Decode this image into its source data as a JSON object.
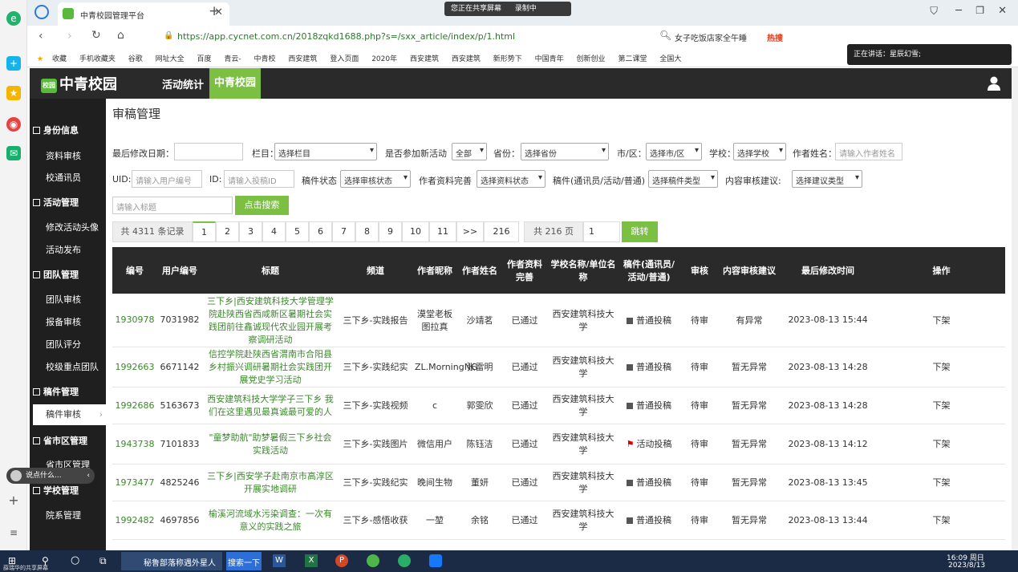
{
  "browser": {
    "tab_title": "中青校园管理平台",
    "url": "https://app.cycnet.com.cn/2018zqkd1688.php?s=/sxx_article/index/p/1.html",
    "search_hint": "女子吃饭店家全午睡",
    "hot_label": "热搜",
    "share_status": "您正在共享屏幕",
    "recording": "录制中",
    "speaking": "正在讲话：星辰幻雪;",
    "bookmarks": [
      "收藏",
      "手机收藏夹",
      "谷歌",
      "网址大全",
      "百度",
      "青云-",
      "中青校",
      "西安建筑",
      "登入页面",
      "2020年",
      "西安建筑",
      "西安建筑",
      "新形势下",
      "中国青年",
      "创新创业",
      "第二课堂",
      "全国大"
    ]
  },
  "header": {
    "logo": "中青校园",
    "logo_badge": "校园",
    "nav": [
      "活动统计",
      "中青校园"
    ]
  },
  "sidebar": {
    "groups": [
      {
        "title": "身份信息",
        "items": [
          "资料审核",
          "校通讯员"
        ]
      },
      {
        "title": "活动管理",
        "items": [
          "修改活动头像",
          "活动发布"
        ]
      },
      {
        "title": "团队管理",
        "items": [
          "团队审核",
          "报备审核",
          "团队评分",
          "校级重点团队"
        ]
      },
      {
        "title": "稿件管理",
        "items": [
          "稿件审核"
        ]
      },
      {
        "title": "省市区管理",
        "items": [
          "省市区管理"
        ]
      },
      {
        "title": "学校管理",
        "items": [
          "院系管理"
        ]
      }
    ]
  },
  "page": {
    "title": "审稿管理",
    "filters": {
      "last_modified_label": "最后修改日期：",
      "column_label": "栏目：",
      "column_value": "选择栏目",
      "join_activity_label": "是否参加新活动",
      "join_activity_value": "全部",
      "province_label": "省份：",
      "province_value": "选择省份",
      "city_label": "市/区：",
      "city_value": "选择市/区",
      "school_label": "学校：",
      "school_value": "选择学校",
      "author_name_label": "作者姓名：",
      "author_name_placeholder": "请输入作者姓名",
      "uid_label": "UID:",
      "uid_placeholder": "请输入用户编号",
      "id_label": "ID:",
      "id_placeholder": "请输入投稿ID",
      "status_label": "稿件状态",
      "status_value": "选择审核状态",
      "profile_label": "作者资料完善",
      "profile_value": "选择资料状态",
      "type_label": "稿件(通讯员/活动/普通)",
      "type_value": "选择稿件类型",
      "advice_label": "内容审核建议:",
      "advice_value": "选择建议类型",
      "title_placeholder": "请输入标题",
      "search_button": "点击搜索"
    },
    "pagination": {
      "total_records": "共 4311 条记录",
      "pages": [
        "1",
        "2",
        "3",
        "4",
        "5",
        "6",
        "7",
        "8",
        "9",
        "10",
        "11",
        ">>",
        "216"
      ],
      "total_pages": "共 216 页",
      "goto_value": "1",
      "jump_button": "跳转"
    },
    "table": {
      "headers": [
        "编号",
        "用户编号",
        "标题",
        "频道",
        "作者昵称",
        "作者姓名",
        "作者资料完善",
        "学校名称/单位名称",
        "稿件(通讯员/活动/普通)",
        "审核",
        "内容审核建议",
        "最后修改时间",
        "操作"
      ],
      "rows": [
        {
          "id": "1930978",
          "uid": "7031982",
          "title": "三下乡|西安建筑科技大学管理学院赴陕西省西咸新区暑期社会实践团前往鑫诚现代农业园开展考察调研活动",
          "channel": "三下乡-实践报告",
          "nick": "漠堂老板图拉真",
          "name": "沙靖茗",
          "profile": "已通过",
          "school": "西安建筑科技大学",
          "kind": "普通投稿",
          "flag": false,
          "review": "待审",
          "advice": "有异常",
          "time": "2023-08-13 15:44",
          "op": "下架"
        },
        {
          "id": "1992663",
          "uid": "6671142",
          "title": "信控学院赴陕西省渭南市合阳县乡村振兴调研暑期社会实践团开展党史学习活动",
          "channel": "三下乡-实践纪实",
          "nick": "ZL.MorningNG",
          "name": "张雷明",
          "profile": "已通过",
          "school": "西安建筑科技大学",
          "kind": "普通投稿",
          "flag": false,
          "review": "待审",
          "advice": "暂无异常",
          "time": "2023-08-13 14:28",
          "op": "下架"
        },
        {
          "id": "1992686",
          "uid": "5163673",
          "title": "西安建筑科技大学学子三下乡 我们在这里遇见最真诚最可爱的人",
          "channel": "三下乡-实践视频",
          "nick": "c",
          "name": "郭雯欣",
          "profile": "已通过",
          "school": "西安建筑科技大学",
          "kind": "普通投稿",
          "flag": false,
          "review": "待审",
          "advice": "暂无异常",
          "time": "2023-08-13 14:28",
          "op": "下架"
        },
        {
          "id": "1943738",
          "uid": "7101833",
          "title": "\"童梦助航\"助梦暑假三下乡社会实践活动",
          "channel": "三下乡-实践图片",
          "nick": "微信用户",
          "name": "陈钰洁",
          "profile": "已通过",
          "school": "西安建筑科技大学",
          "kind": "活动投稿",
          "flag": true,
          "review": "待审",
          "advice": "暂无异常",
          "time": "2023-08-13 14:12",
          "op": "下架"
        },
        {
          "id": "1973477",
          "uid": "4825246",
          "title": "三下乡|西安学子赴南京市高淳区开展实地调研",
          "channel": "三下乡-实践纪实",
          "nick": "晚间生物",
          "name": "董妍",
          "profile": "已通过",
          "school": "西安建筑科技大学",
          "kind": "普通投稿",
          "flag": false,
          "review": "待审",
          "advice": "暂无异常",
          "time": "2023-08-13 13:45",
          "op": "下架"
        },
        {
          "id": "1992482",
          "uid": "4697856",
          "title": "榆溪河流域水污染调查：一次有意义的实践之旅",
          "channel": "三下乡-感悟收获",
          "nick": "一堃",
          "name": "余铭",
          "profile": "已通过",
          "school": "西安建筑科技大学",
          "kind": "普通投稿",
          "flag": false,
          "review": "待审",
          "advice": "暂无异常",
          "time": "2023-08-13 13:44",
          "op": "下架"
        }
      ]
    }
  },
  "speak_widget": "说点什么...",
  "taskbar": {
    "app1": "秘鲁部落称遇外星人",
    "search": "搜索一下",
    "time": "16:09 周日",
    "date": "2023/8/13",
    "sharer": "薛瑞华的共享屏幕"
  },
  "colors": {
    "accent": "#7bc043",
    "nav_dark": "#2a2a2a",
    "link_green": "#3a8a2a"
  }
}
